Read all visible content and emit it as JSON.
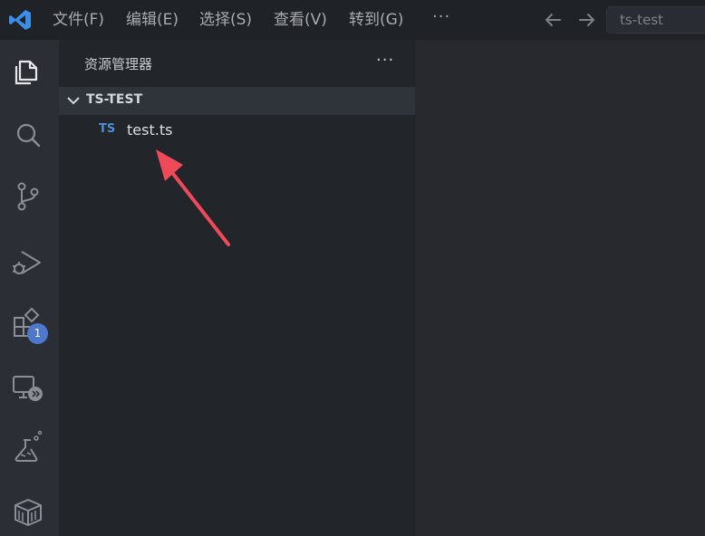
{
  "menu": {
    "items": [
      "文件(F)",
      "编辑(E)",
      "选择(S)",
      "查看(V)",
      "转到(G)"
    ],
    "more": "···"
  },
  "search": {
    "text": "ts-test"
  },
  "activity": {
    "icons": [
      "explorer-icon",
      "search-icon",
      "source-control-icon",
      "run-debug-icon",
      "extensions-icon",
      "remote-explorer-icon",
      "testing-icon",
      "packages-icon"
    ],
    "extensions_badge": "1"
  },
  "sidebar": {
    "title": "资源管理器",
    "more": "···",
    "folder": "TS-TEST",
    "files": [
      {
        "badge": "TS",
        "name": "test.ts"
      }
    ]
  },
  "colors": {
    "accent": "#4d78cc",
    "ts_blue": "#4a8fd6",
    "annotation": "#f04a5a"
  }
}
